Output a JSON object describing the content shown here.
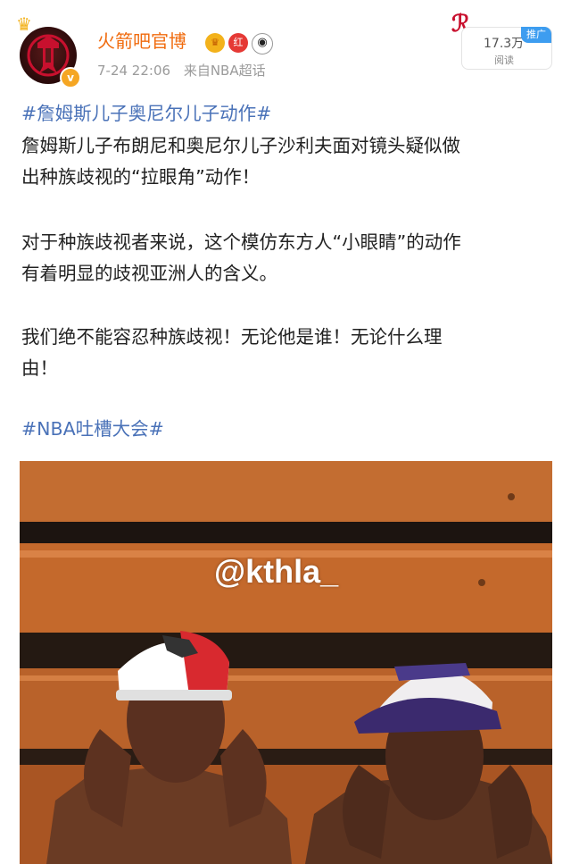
{
  "post": {
    "author": "火箭吧官博",
    "timestamp": "7-24 22:06",
    "source": "来自NBA超话",
    "badge_hong": "红",
    "promo_tag": "推广",
    "views_count": "17.3万",
    "views_label": "阅读",
    "paragraphs": [
      "#詹姆斯儿子奥尼尔儿子动作#",
      "詹姆斯儿子布朗尼和奥尼尔儿子沙利夫面对镜头疑似做",
      "出种族歧视的“拉眼角”动作！",
      "对于种族歧视者来说，这个模仿东方人“小眼睛”的动作",
      "有着明显的歧视亚洲人的含义。",
      "我们绝不能容忍种族歧视！无论他是谁！无论什么理",
      "由！",
      "#NBA吐槽大会#"
    ],
    "image_watermark": "@kthla_"
  },
  "colors": {
    "username": "#f06b0e",
    "hashtag": "#4a72b8",
    "meta": "#9b9b9b",
    "promo": "#3d9df0"
  },
  "icons": {
    "crown": "crown-icon",
    "verified": "verified-v-icon",
    "rockets_logo": "houston-rockets-logo",
    "panda": "panda-icon"
  }
}
